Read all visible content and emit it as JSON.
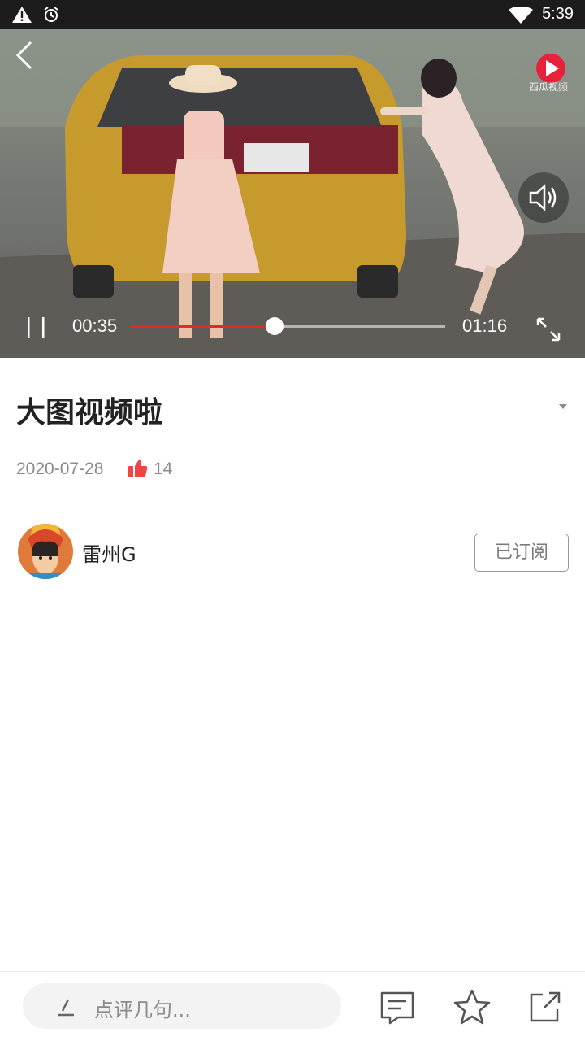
{
  "status_bar": {
    "time": "5:39",
    "icons": [
      "warning-icon",
      "alarm-icon",
      "wifi-icon"
    ]
  },
  "video": {
    "watermark": "西瓜视频",
    "current_time": "00:35",
    "total_time": "01:16",
    "progress": 0.46,
    "progress_color": "#e02b2b"
  },
  "post": {
    "title": "大图视频啦",
    "date": "2020-07-28",
    "likes": "14"
  },
  "author": {
    "name": "雷州G",
    "subscribe_label": "已订阅"
  },
  "bottom_bar": {
    "comment_placeholder": "点评几句...",
    "icons": [
      "comment-list-icon",
      "star-icon",
      "share-icon"
    ]
  }
}
